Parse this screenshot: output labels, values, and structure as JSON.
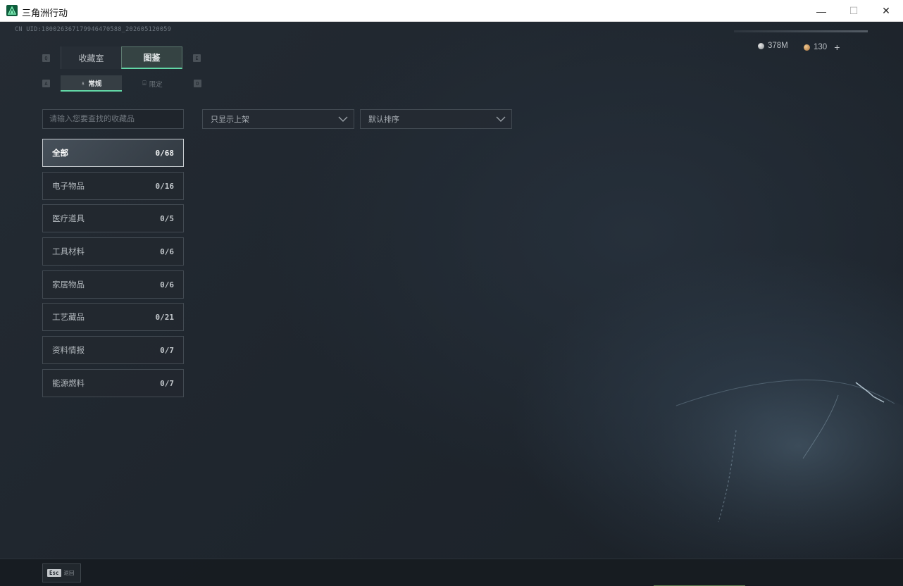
{
  "window": {
    "title": "三角洲行动",
    "minimize": "—",
    "maximize": "☐",
    "close": "✕"
  },
  "uid": "CN UID:1800263671799464705​88_202605120059",
  "currency": {
    "silver_amount": "378M",
    "gold_amount": "130",
    "add": "+"
  },
  "keyhints": {
    "prev_tab": "Q",
    "next_tab": "E",
    "prev_sub": "A",
    "next_sub": "D"
  },
  "tabs": [
    {
      "label": "收藏室",
      "active": false
    },
    {
      "label": "图鉴",
      "active": true
    }
  ],
  "subtabs": [
    {
      "label": "常规",
      "active": true
    },
    {
      "label": "限定",
      "active": false
    }
  ],
  "filters": {
    "search_placeholder": "请输入您要查找的收藏品",
    "show_select": "只显示上架",
    "sort_select": "默认排序"
  },
  "categories": [
    {
      "label": "全部",
      "count": "0/68",
      "active": true
    },
    {
      "label": "电子物品",
      "count": "0/16",
      "active": false
    },
    {
      "label": "医疗道具",
      "count": "0/5",
      "active": false
    },
    {
      "label": "工具材料",
      "count": "0/6",
      "active": false
    },
    {
      "label": "家居物品",
      "count": "0/6",
      "active": false
    },
    {
      "label": "工艺藏品",
      "count": "0/21",
      "active": false
    },
    {
      "label": "资料情报",
      "count": "0/7",
      "active": false
    },
    {
      "label": "能源燃料",
      "count": "0/7",
      "active": false
    }
  ],
  "bottom": {
    "esc_key": "Esc",
    "esc_label": "返回"
  },
  "colors": {
    "accent": "#62d7a6",
    "background": "#1b2128"
  }
}
